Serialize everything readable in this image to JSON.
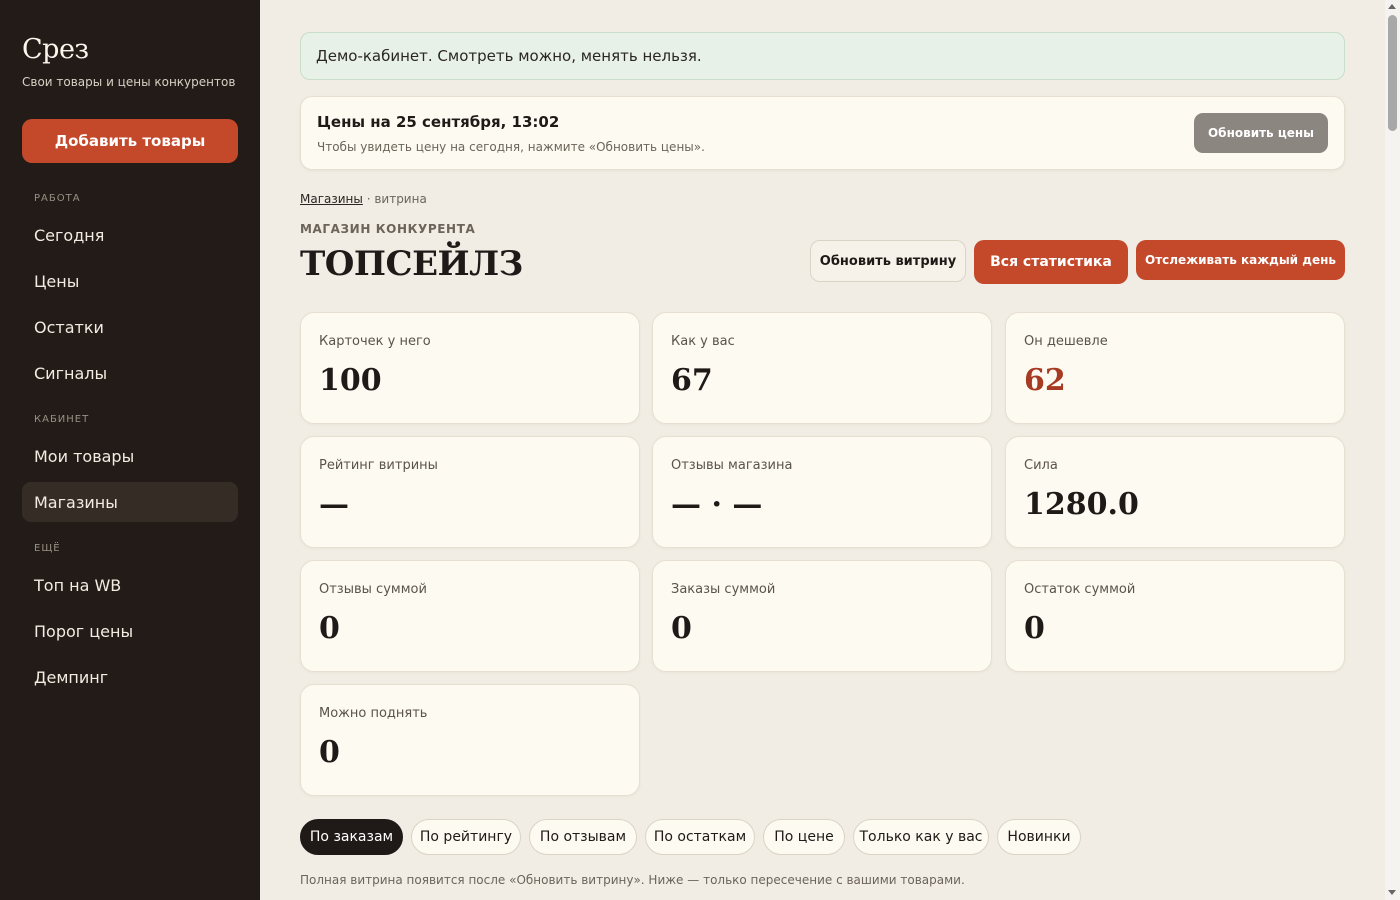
{
  "sidebar": {
    "brand": "Срез",
    "tagline": "Свои товары и цены конкурентов",
    "add_button": "Добавить товары",
    "sections": [
      {
        "label": "РАБОТА",
        "items": [
          "Сегодня",
          "Цены",
          "Остатки",
          "Сигналы"
        ]
      },
      {
        "label": "КАБИНЕТ",
        "items": [
          "Мои товары",
          "Магазины"
        ]
      },
      {
        "label": "ЕЩЁ",
        "items": [
          "Топ на WB",
          "Порог цены",
          "Демпинг"
        ]
      }
    ],
    "active_item": "Магазины"
  },
  "banner": {
    "text": "Демо-кабинет. Смотреть можно, менять нельзя."
  },
  "prices_card": {
    "title": "Цены на 25 сентября, 13:02",
    "subtitle": "Чтобы увидеть цену на сегодня, нажмите «Обновить цены».",
    "button": "Обновить цены"
  },
  "breadcrumb": {
    "link": "Магазины",
    "separator": " · ",
    "current": "витрина"
  },
  "shop": {
    "eyebrow": "МАГАЗИН КОНКУРЕНТА",
    "name": "ТОПСЕЙЛЗ",
    "actions": {
      "refresh_showcase": "Обновить витрину",
      "all_stats": "Вся статистика",
      "track_daily": "Отслеживать каждый день"
    }
  },
  "stats": [
    {
      "label": "Карточек у него",
      "value": "100"
    },
    {
      "label": "Как у вас",
      "value": "67"
    },
    {
      "label": "Он дешевле",
      "value": "62"
    },
    {
      "label": "Рейтинг витрины",
      "value": "—"
    },
    {
      "label": "Отзывы магазина",
      "value": "— · —"
    },
    {
      "label": "Сила",
      "value": "1280.0"
    },
    {
      "label": "Отзывы суммой",
      "value": "0"
    },
    {
      "label": "Заказы суммой",
      "value": "0"
    },
    {
      "label": "Остаток суммой",
      "value": "0"
    },
    {
      "label": "Можно поднять",
      "value": "0"
    }
  ],
  "sort_chips": [
    "По заказам",
    "По рейтингу",
    "По отзывам",
    "По остаткам",
    "По цене",
    "Только как у вас",
    "Новинки"
  ],
  "active_chip": "По заказам",
  "footnote": "Полная витрина появится после «Обновить витрину». Ниже — только пересечение с вашими товарами.",
  "colors": {
    "sidebar_bg": "#221b17",
    "page_bg": "#f1ede4",
    "accent": "#c4482a",
    "accent_text": "#a63a22",
    "banner_bg": "#e8f1e8"
  }
}
